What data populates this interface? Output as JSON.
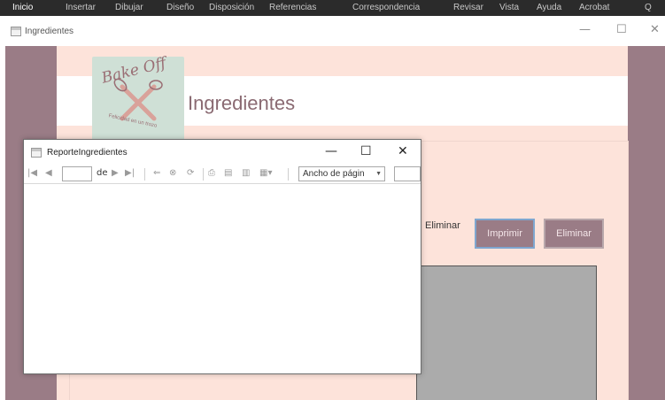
{
  "ribbon": {
    "tabs": [
      {
        "label": "Inicio"
      },
      {
        "label": "Insertar"
      },
      {
        "label": "Dibujar"
      },
      {
        "label": "Diseño"
      },
      {
        "label": "Disposición"
      },
      {
        "label": "Referencias"
      },
      {
        "label": "Correspondencia"
      },
      {
        "label": "Revisar"
      },
      {
        "label": "Vista"
      },
      {
        "label": "Ayuda"
      },
      {
        "label": "Acrobat"
      }
    ],
    "search_glyph": "Q"
  },
  "main_window": {
    "title": "Ingredientes",
    "controls": {
      "minimize": "—",
      "maximize": "☐",
      "close": "✕"
    }
  },
  "form": {
    "logo": {
      "text": "Bake Off",
      "slogan": "Felicidad en un trozo"
    },
    "title": "Ingredientes",
    "partial_label": "Eliminar",
    "buttons": {
      "print": "Imprimir",
      "delete": "Eliminar"
    }
  },
  "report_window": {
    "title": "ReporteIngredientes",
    "controls": {
      "minimize": "—",
      "maximize": "☐",
      "close": "✕"
    },
    "toolbar": {
      "first": "|◀",
      "prev": "◀",
      "page_value": "",
      "of_label": "de",
      "next": "▶",
      "last": "▶|",
      "back": "⇐",
      "stop": "⊗",
      "refresh": "⟳",
      "print": "⎙",
      "layout": "▤",
      "page_setup": "▥",
      "export": "▦▾",
      "zoom_value": "Ancho de págin",
      "search_value": ""
    }
  },
  "colors": {
    "accent_mauve": "#9a7c86",
    "peach_bg": "#fde3da",
    "logo_mint": "#cfe0d6",
    "focus_border": "#7fa6cf"
  }
}
